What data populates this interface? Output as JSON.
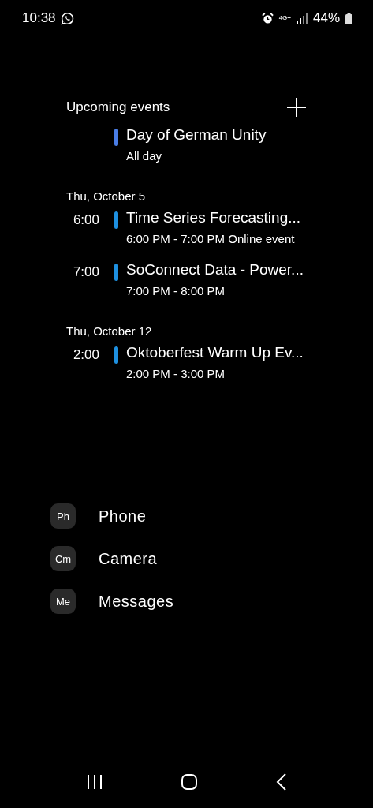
{
  "status_bar": {
    "time": "10:38",
    "network": "4G+",
    "battery_text": "44%"
  },
  "widget": {
    "title": "Upcoming events",
    "groups": [
      {
        "events": [
          {
            "title": "Day of German Unity",
            "subtitle": "All day",
            "color": "#4a7de6"
          }
        ]
      },
      {
        "date": "Thu, October 5",
        "events": [
          {
            "time": "6:00",
            "title": "Time Series Forecasting...",
            "subtitle": "6:00 PM - 7:00 PM Online event",
            "color": "#1e90e0"
          },
          {
            "time": "7:00",
            "title": "SoConnect Data - Power...",
            "subtitle": "7:00 PM - 8:00 PM",
            "color": "#1e90e0"
          }
        ]
      },
      {
        "date": "Thu, October 12",
        "events": [
          {
            "time": "2:00",
            "title": "Oktoberfest Warm Up Ev...",
            "subtitle": "2:00 PM - 3:00 PM",
            "color": "#1e90e0"
          }
        ]
      }
    ]
  },
  "apps": [
    {
      "abbr": "Ph",
      "name": "Phone"
    },
    {
      "abbr": "Cm",
      "name": "Camera"
    },
    {
      "abbr": "Me",
      "name": "Messages"
    }
  ]
}
